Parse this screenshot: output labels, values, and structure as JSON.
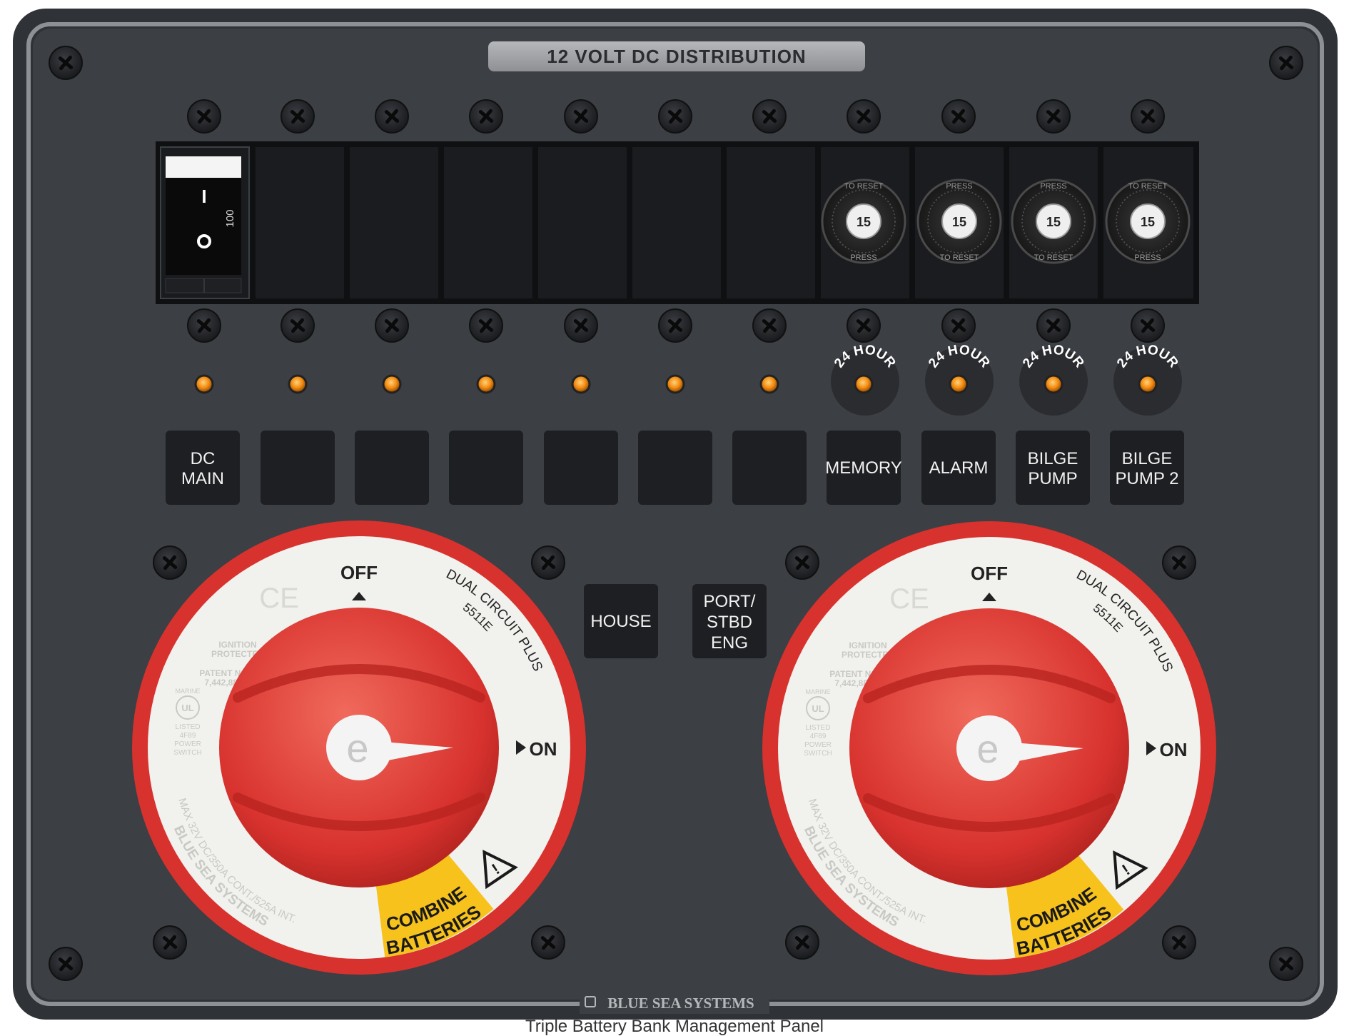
{
  "panel": {
    "title": "12 VOLT DC DISTRIBUTION",
    "brand": "BLUE SEA SYSTEMS",
    "caption": "Triple Battery Bank Management Panel",
    "colors": {
      "panel": "#3c3f44",
      "frame": "#2b2d31",
      "accent_red": "#d8322e",
      "led": "#f28a0f",
      "label_box": "#1e1f22",
      "warning_yellow": "#f6c21b"
    }
  },
  "main_breaker": {
    "rating": "100",
    "on_mark": "I",
    "off_mark": "O",
    "state": "on"
  },
  "fuse_holders": [
    {
      "rating": "15",
      "ring_text_a": "PRESS",
      "ring_text_b": "TO RESET"
    },
    {
      "rating": "15",
      "ring_text_a": "PRESS",
      "ring_text_b": "TO RESET"
    },
    {
      "rating": "15",
      "ring_text_a": "PRESS",
      "ring_text_b": "TO RESET"
    },
    {
      "rating": "15",
      "ring_text_a": "PRESS",
      "ring_text_b": "TO RESET"
    }
  ],
  "always_on_badge": "24 HOUR",
  "circuit_labels": [
    {
      "line1": "DC",
      "line2": "MAIN"
    },
    {
      "line1": "",
      "line2": ""
    },
    {
      "line1": "",
      "line2": ""
    },
    {
      "line1": "",
      "line2": ""
    },
    {
      "line1": "",
      "line2": ""
    },
    {
      "line1": "",
      "line2": ""
    },
    {
      "line1": "",
      "line2": ""
    },
    {
      "line1": "MEMORY",
      "line2": ""
    },
    {
      "line1": "ALARM",
      "line2": ""
    },
    {
      "line1": "BILGE",
      "line2": "PUMP"
    },
    {
      "line1": "BILGE",
      "line2": "PUMP 2"
    }
  ],
  "battery_labels": [
    {
      "lines": [
        "HOUSE"
      ]
    },
    {
      "lines": [
        "PORT/",
        "STBD",
        "ENG"
      ]
    }
  ],
  "battery_switches": [
    {
      "off_label": "OFF",
      "on_label": "ON",
      "model_a": "DUAL CIRCUIT PLUS",
      "model_b": "5511E",
      "ce_mark": "CE",
      "ignition": [
        "IGNITION",
        "PROTECTED"
      ],
      "patent": [
        "PATENT NO",
        "7,442,887"
      ],
      "ul": [
        "MARINE",
        "UL",
        "LISTED",
        "4F89",
        "POWER",
        "SWITCH"
      ],
      "brand_ring": "BLUE SEA SYSTEMS",
      "rating_ring": "MAX 32V DC/350A CONT./525A INT.",
      "warning": [
        "COMBINE",
        "BATTERIES"
      ],
      "knob_logo": "e",
      "position": "on"
    },
    {
      "off_label": "OFF",
      "on_label": "ON",
      "model_a": "DUAL CIRCUIT PLUS",
      "model_b": "5511E",
      "ce_mark": "CE",
      "ignition": [
        "IGNITION",
        "PROTECTED"
      ],
      "patent": [
        "PATENT NO",
        "7,442,887"
      ],
      "ul": [
        "MARINE",
        "UL",
        "LISTED",
        "4F89",
        "POWER",
        "SWITCH"
      ],
      "brand_ring": "BLUE SEA SYSTEMS",
      "rating_ring": "MAX 32V DC/350A CONT./525A INT.",
      "warning": [
        "COMBINE",
        "BATTERIES"
      ],
      "knob_logo": "e",
      "position": "on"
    }
  ],
  "icons": {
    "screw": "phillips-screw-icon",
    "led": "indicator-led-icon",
    "warning": "warning-triangle-icon",
    "brand_logo": "blue-sea-logo-icon"
  }
}
